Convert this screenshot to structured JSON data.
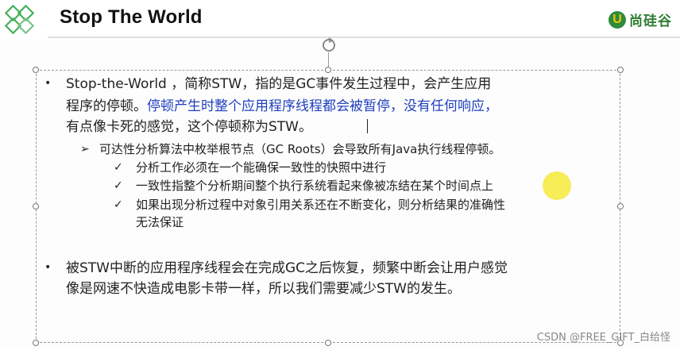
{
  "header": {
    "title": "Stop The World",
    "brand_mark": "U",
    "brand_text": "尚硅谷",
    "brand_color": "#2e7d32"
  },
  "bullets": [
    {
      "marker": "•",
      "line1": "Stop-the-World ，简称STW，指的是GC事件发生过程中，会产生应用",
      "line2_black": "程序的停顿。",
      "line2_blue": "停顿产生时整个应用程序线程都会被暂停，没有任何响应，",
      "line3": "有点像卡死的感觉，这个停顿称为STW。"
    },
    {
      "marker": "•",
      "line1": "被STW中断的应用程序线程会在完成GC之后恢复，频繁中断会让用户感觉",
      "line2": "像是网速不快造成电影卡带一样，所以我们需要减少STW的发生。"
    }
  ],
  "sub_point": {
    "marker": "➢",
    "text": "可达性分析算法中枚举根节点（GC Roots）会导致所有Java执行线程停顿。"
  },
  "checks": [
    {
      "marker": "✓",
      "text": "分析工作必须在一个能确保一致性的快照中进行"
    },
    {
      "marker": "✓",
      "text": "一致性指整个分析期间整个执行系统看起来像被冻结在某个时间点上"
    },
    {
      "marker": "✓",
      "line1": "如果出现分析过程中对象引用关系还在不断变化，则分析结果的准确性",
      "line2": "无法保证"
    }
  ],
  "watermark": "CSDN @FREE_GIFT_白给怪",
  "colors": {
    "accent_blue": "#1f3fbf",
    "highlight": "#f4ea3a"
  }
}
